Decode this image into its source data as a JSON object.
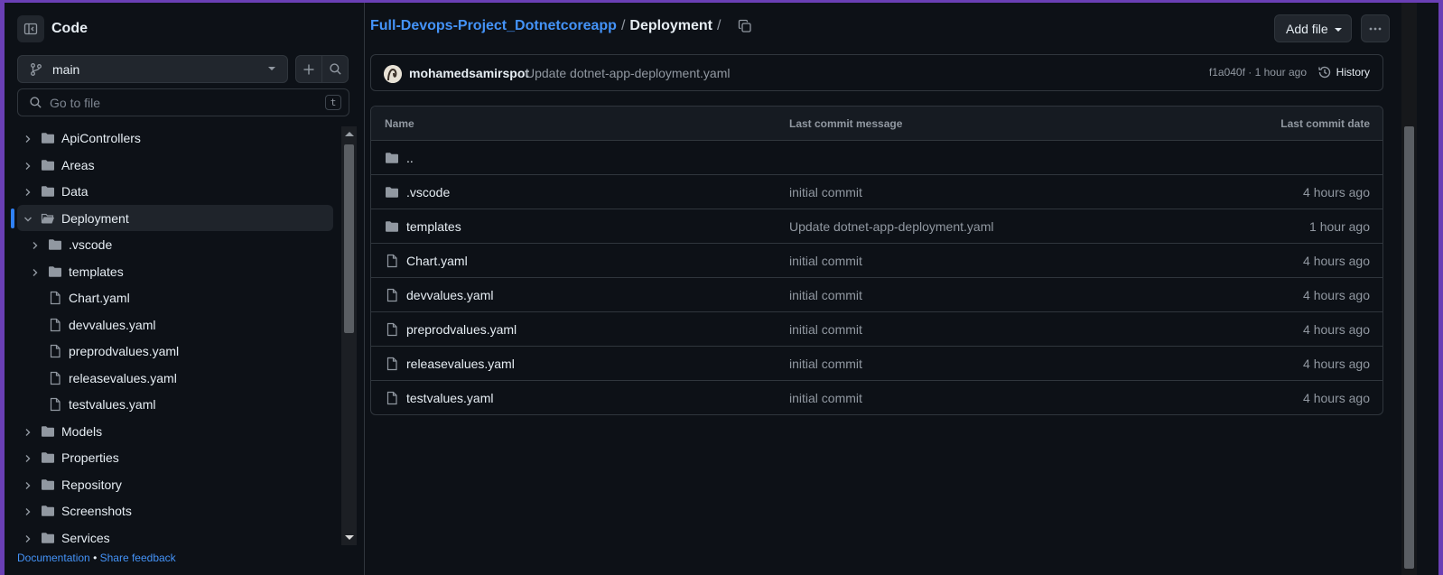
{
  "sidebar": {
    "title": "Code",
    "branch": "main",
    "goto_placeholder": "Go to file",
    "goto_shortcut": "t",
    "tree": [
      {
        "label": "ApiControllers",
        "type": "folder",
        "depth": 0,
        "expanded": false
      },
      {
        "label": "Areas",
        "type": "folder",
        "depth": 0,
        "expanded": false
      },
      {
        "label": "Data",
        "type": "folder",
        "depth": 0,
        "expanded": false
      },
      {
        "label": "Deployment",
        "type": "folder",
        "depth": 0,
        "expanded": true,
        "active": true
      },
      {
        "label": ".vscode",
        "type": "folder",
        "depth": 1,
        "expanded": false
      },
      {
        "label": "templates",
        "type": "folder",
        "depth": 1,
        "expanded": false
      },
      {
        "label": "Chart.yaml",
        "type": "file",
        "depth": 1
      },
      {
        "label": "devvalues.yaml",
        "type": "file",
        "depth": 1
      },
      {
        "label": "preprodvalues.yaml",
        "type": "file",
        "depth": 1
      },
      {
        "label": "releasevalues.yaml",
        "type": "file",
        "depth": 1
      },
      {
        "label": "testvalues.yaml",
        "type": "file",
        "depth": 1
      },
      {
        "label": "Models",
        "type": "folder",
        "depth": 0,
        "expanded": false
      },
      {
        "label": "Properties",
        "type": "folder",
        "depth": 0,
        "expanded": false
      },
      {
        "label": "Repository",
        "type": "folder",
        "depth": 0,
        "expanded": false
      },
      {
        "label": "Screenshots",
        "type": "folder",
        "depth": 0,
        "expanded": false
      },
      {
        "label": "Services",
        "type": "folder",
        "depth": 0,
        "expanded": false
      }
    ],
    "footer": {
      "documentation": "Documentation",
      "bullet": "•",
      "feedback": "Share feedback"
    }
  },
  "breadcrumb": {
    "repo": "Full-Devops-Project_Dotnetcoreapp",
    "separator": "/",
    "current": "Deployment",
    "trailing": "/"
  },
  "toolbar": {
    "add_file": "Add file"
  },
  "commit": {
    "author": "mohamedsamirspot",
    "message": "Update dotnet-app-deployment.yaml",
    "hash_time": "f1a040f · 1 hour ago",
    "history": "History"
  },
  "table": {
    "headers": {
      "name": "Name",
      "message": "Last commit message",
      "date": "Last commit date"
    },
    "rows": [
      {
        "name": "..",
        "type": "parent",
        "message": "",
        "date": ""
      },
      {
        "name": ".vscode",
        "type": "folder",
        "message": "initial commit",
        "date": "4 hours ago"
      },
      {
        "name": "templates",
        "type": "folder",
        "message": "Update dotnet-app-deployment.yaml",
        "date": "1 hour ago"
      },
      {
        "name": "Chart.yaml",
        "type": "file",
        "message": "initial commit",
        "date": "4 hours ago"
      },
      {
        "name": "devvalues.yaml",
        "type": "file",
        "message": "initial commit",
        "date": "4 hours ago"
      },
      {
        "name": "preprodvalues.yaml",
        "type": "file",
        "message": "initial commit",
        "date": "4 hours ago"
      },
      {
        "name": "releasevalues.yaml",
        "type": "file",
        "message": "initial commit",
        "date": "4 hours ago"
      },
      {
        "name": "testvalues.yaml",
        "type": "file",
        "message": "initial commit",
        "date": "4 hours ago"
      }
    ]
  },
  "colors": {
    "accent": "#4493f8",
    "background": "#0d1117",
    "border": "#30363d",
    "muted": "#9198a1",
    "icon": "#9198a1"
  }
}
